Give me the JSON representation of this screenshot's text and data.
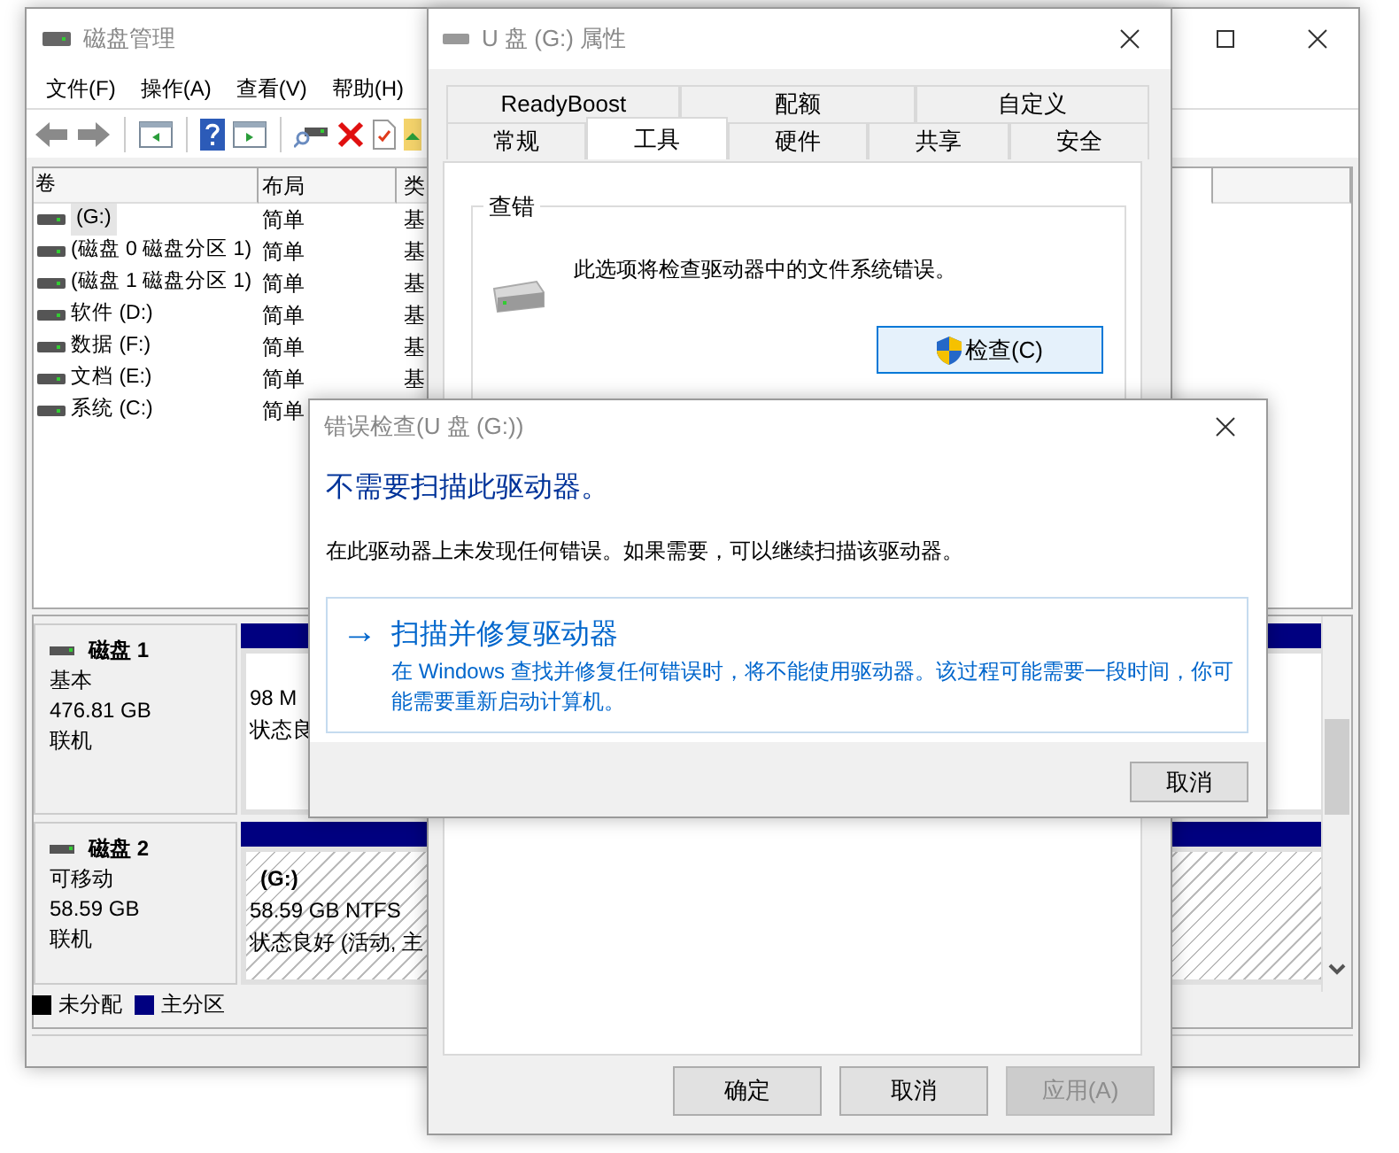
{
  "disk_management": {
    "title": "磁盘管理",
    "menu": [
      "文件(F)",
      "操作(A)",
      "查看(V)",
      "帮助(H)"
    ],
    "volume_table": {
      "columns": [
        "卷",
        "布局",
        "类"
      ],
      "rows": [
        {
          "cells": [
            "(G:)",
            "简单",
            "基"
          ],
          "selected": true
        },
        {
          "cells": [
            "(磁盘 0 磁盘分区 1)",
            "简单",
            "基"
          ],
          "selected": false
        },
        {
          "cells": [
            "(磁盘 1 磁盘分区 1)",
            "简单",
            "基"
          ],
          "selected": false
        },
        {
          "cells": [
            "软件 (D:)",
            "简单",
            "基"
          ],
          "selected": false
        },
        {
          "cells": [
            "数据 (F:)",
            "简单",
            "基"
          ],
          "selected": false
        },
        {
          "cells": [
            "文档 (E:)",
            "简单",
            "基"
          ],
          "selected": false
        },
        {
          "cells": [
            "系统 (C:)",
            "简单"
          ],
          "selected": false
        }
      ]
    },
    "disks": [
      {
        "name": "磁盘 1",
        "type": "基本",
        "size": "476.81 GB",
        "status": "联机",
        "partition": {
          "lines": [
            "98 M",
            "状态良"
          ],
          "selected": false
        }
      },
      {
        "name": "磁盘 2",
        "type": "可移动",
        "size": "58.59 GB",
        "status": "联机",
        "partition": {
          "label": "(G:)",
          "lines": [
            "58.59 GB NTFS",
            "状态良好 (活动, 主"
          ],
          "selected": true
        }
      }
    ],
    "legend": [
      {
        "label": "未分配",
        "color": "#000000"
      },
      {
        "label": "主分区",
        "color": "#000080"
      }
    ]
  },
  "properties": {
    "title": "U 盘 (G:) 属性",
    "tab_rows": [
      [
        {
          "label": "ReadyBoost",
          "selected": false
        },
        {
          "label": "配额",
          "selected": false
        },
        {
          "label": "自定义",
          "selected": false
        }
      ],
      [
        {
          "label": "常规",
          "selected": false
        },
        {
          "label": "工具",
          "selected": true
        },
        {
          "label": "硬件",
          "selected": false
        },
        {
          "label": "共享",
          "selected": false
        },
        {
          "label": "安全",
          "selected": false
        }
      ]
    ],
    "group": {
      "title": "查错",
      "text": "此选项将检查驱动器中的文件系统错误。",
      "button": "检查(C)"
    },
    "buttons": [
      {
        "label": "确定",
        "disabled": false
      },
      {
        "label": "取消",
        "disabled": false
      },
      {
        "label": "应用(A)",
        "disabled": true
      }
    ]
  },
  "error_check": {
    "title": "错误检查(U 盘 (G:))",
    "heading": "不需要扫描此驱动器。",
    "message": "在此驱动器上未发现任何错误。如果需要，可以继续扫描该驱动器。",
    "action": {
      "arrow": "→",
      "title": "扫描并修复驱动器",
      "description": "在 Windows 查找并修复任何错误时，将不能使用驱动器。该过程可能需要一段时间，你可能需要重新启动计算机。"
    },
    "cancel": "取消"
  }
}
